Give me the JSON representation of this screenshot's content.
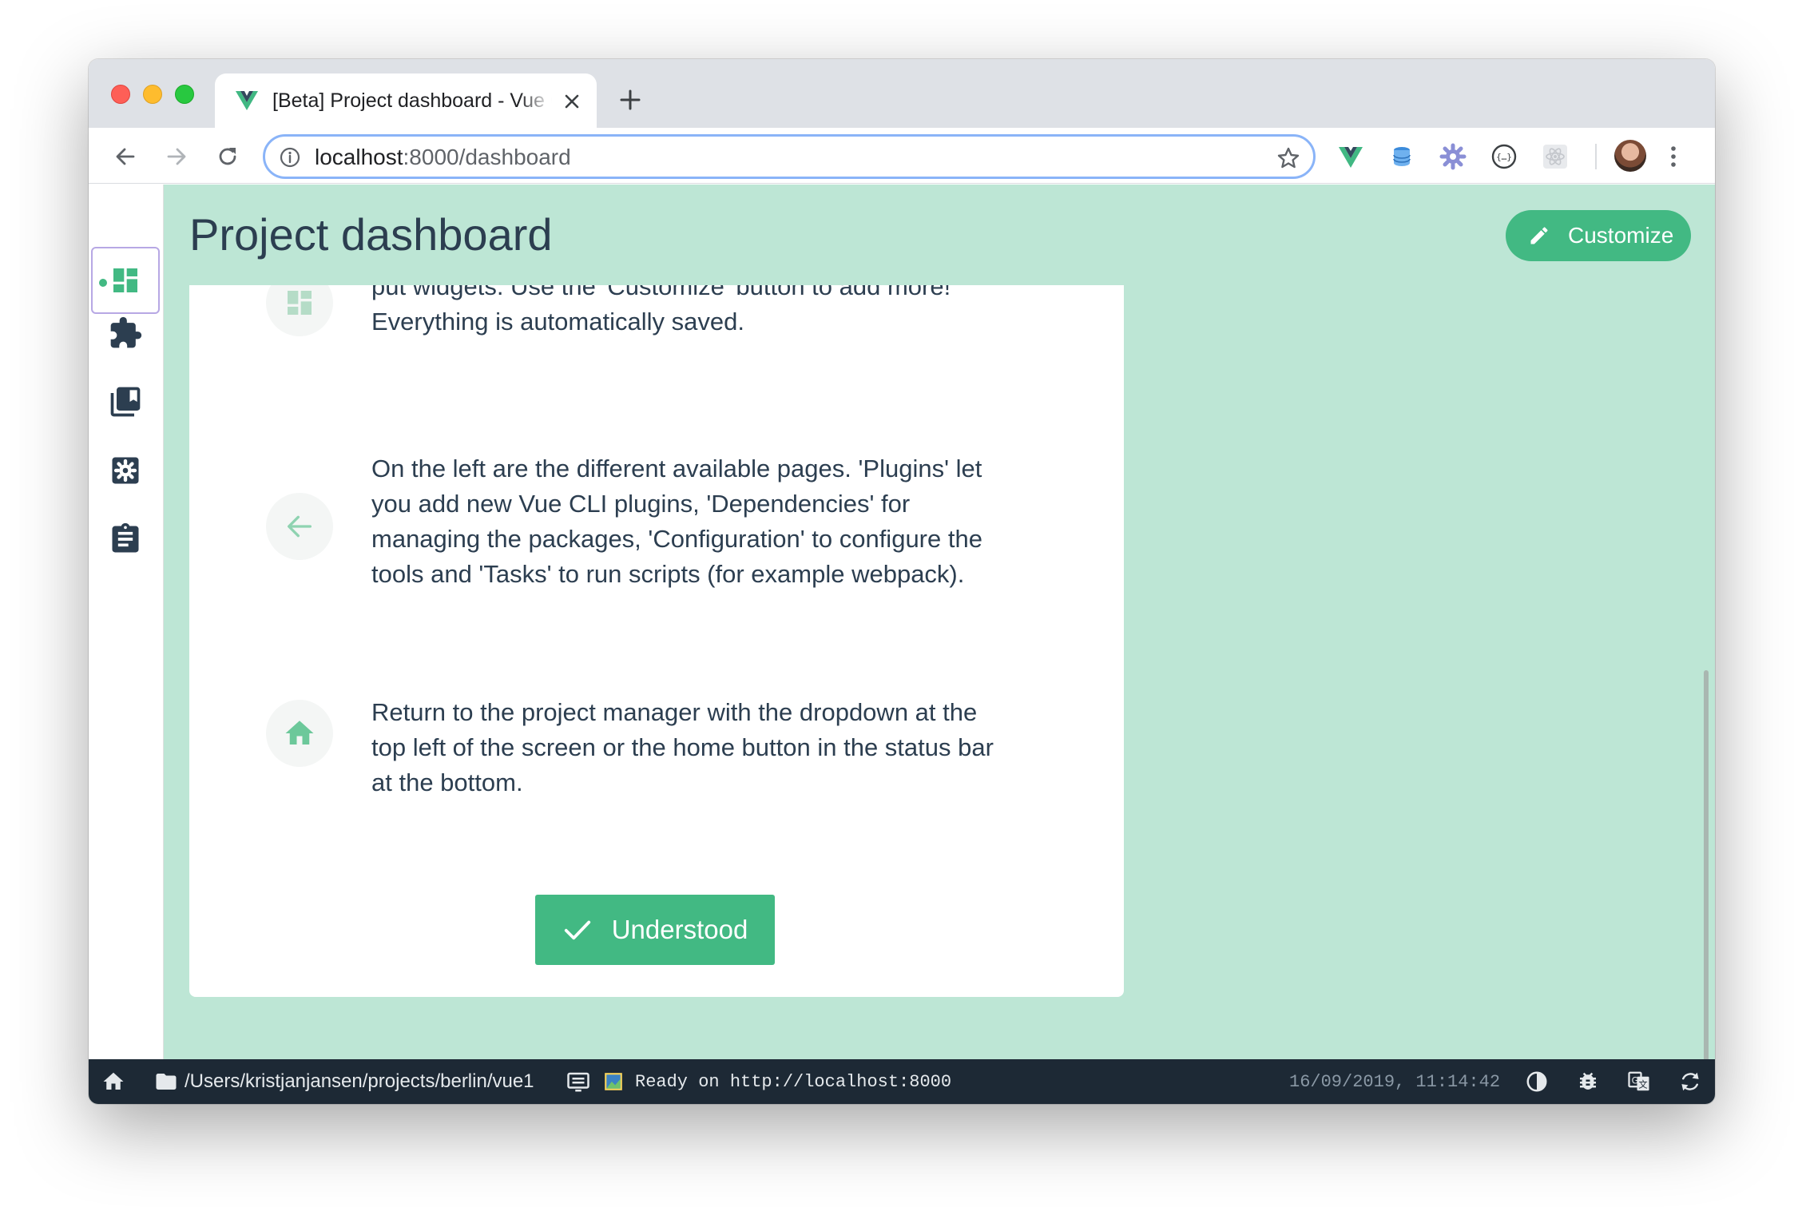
{
  "browser": {
    "tab_title": "[Beta] Project dashboard - Vue CLI",
    "url_host": "localhost",
    "url_rest": ":8000/dashboard",
    "extensions": [
      "vue-devtools-icon",
      "database-extension-icon",
      "settings-extension-icon",
      "json-extension-icon",
      "react-devtools-icon"
    ]
  },
  "sidebar": {
    "items": [
      {
        "name": "dashboard",
        "icon": "dashboard-icon",
        "active": true
      },
      {
        "name": "plugins",
        "icon": "puzzle-icon",
        "active": false
      },
      {
        "name": "dependencies",
        "icon": "library-books-icon",
        "active": false
      },
      {
        "name": "configuration",
        "icon": "settings-box-icon",
        "active": false
      },
      {
        "name": "tasks",
        "icon": "clipboard-icon",
        "active": false
      }
    ]
  },
  "header": {
    "title": "Project dashboard",
    "customize_label": "Customize"
  },
  "onboarding": {
    "tips": [
      {
        "icon": "dashboard-icon",
        "lines": [
          "put widgets. Use the 'Customize' button to add more!",
          "Everything is automatically saved."
        ]
      },
      {
        "icon": "arrow-left-icon",
        "lines": [
          "On the left are the different available pages. 'Plugins' let",
          "you add new Vue CLI plugins, 'Dependencies' for",
          "managing the packages, 'Configuration' to configure the",
          "tools and 'Tasks' to run scripts (for example webpack)."
        ]
      },
      {
        "icon": "home-icon",
        "lines": [
          "Return to the project manager with the dropdown at the",
          "top left of the screen or the home button in the status bar",
          "at the bottom."
        ]
      }
    ],
    "understood_label": "Understood"
  },
  "statusbar": {
    "path": "/Users/kristjanjansen/projects/berlin/vue1",
    "log": "Ready on http://localhost:8000",
    "timestamp": "16/09/2019, 11:14:42"
  },
  "colors": {
    "accent": "#42b983",
    "app_background": "#bde6d5",
    "statusbar": "#1d2935",
    "text": "#2c3e50"
  }
}
